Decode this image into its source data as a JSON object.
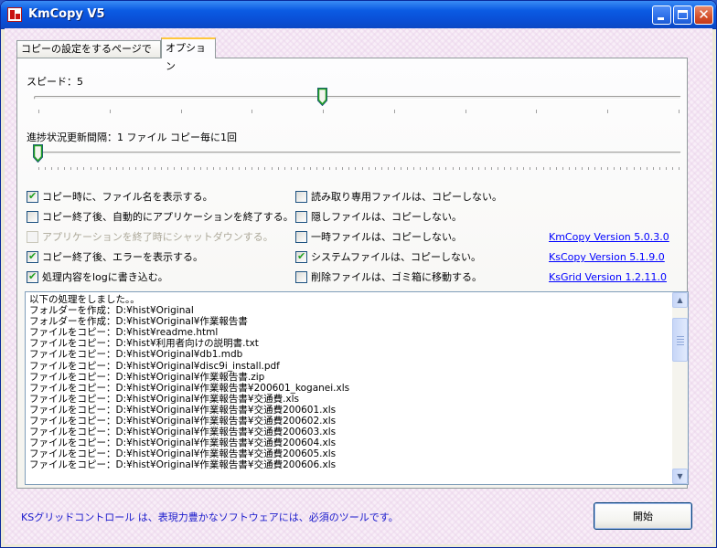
{
  "window": {
    "title": "KmCopy V5"
  },
  "tabs": [
    {
      "label": "コピーの設定をするページです。",
      "active": false
    },
    {
      "label": "オプション",
      "active": true
    }
  ],
  "speed": {
    "label": "スピード：5",
    "value": 5,
    "min": 0,
    "max": 9
  },
  "progress_interval": {
    "label": "進捗状況更新間隔：1 ファイル コピー毎に1回",
    "value": 1
  },
  "checkboxes_left": [
    {
      "label": "コピー時に、ファイル名を表示する。",
      "checked": true,
      "enabled": true
    },
    {
      "label": "コピー終了後、自動的にアプリケーションを終了する。",
      "checked": false,
      "enabled": true
    },
    {
      "label": "アプリケーションを終了時にシャットダウンする。",
      "checked": false,
      "enabled": false
    },
    {
      "label": "コピー終了後、エラーを表示する。",
      "checked": true,
      "enabled": true
    },
    {
      "label": "処理内容をlogに書き込む。",
      "checked": true,
      "enabled": true
    }
  ],
  "checkboxes_right": [
    {
      "label": "読み取り専用ファイルは、コピーしない。",
      "checked": false
    },
    {
      "label": "隠しファイルは、コピーしない。",
      "checked": false
    },
    {
      "label": "一時ファイルは、コピーしない。",
      "checked": false
    },
    {
      "label": "システムファイルは、コピーしない。",
      "checked": true
    },
    {
      "label": "削除ファイルは、ゴミ箱に移動する。",
      "checked": false
    }
  ],
  "version_links": [
    "KmCopy Version 5.0.3.0",
    "KsCopy Version 5.1.9.0",
    "KsGrid Version 1.2.11.0"
  ],
  "log_lines": [
    "以下の処理をしました。。",
    "フォルダーを作成：D:¥hist¥Original",
    "フォルダーを作成：D:¥hist¥Original¥作業報告書",
    "ファイルをコピー：D:¥hist¥readme.html",
    "ファイルをコピー：D:¥hist¥利用者向けの説明書.txt",
    "ファイルをコピー：D:¥hist¥Original¥db1.mdb",
    "ファイルをコピー：D:¥hist¥Original¥disc9i_install.pdf",
    "ファイルをコピー：D:¥hist¥Original¥作業報告書.zip",
    "ファイルをコピー：D:¥hist¥Original¥作業報告書¥200601_koganei.xls",
    "ファイルをコピー：D:¥hist¥Original¥作業報告書¥交通費.xls",
    "ファイルをコピー：D:¥hist¥Original¥作業報告書¥交通費200601.xls",
    "ファイルをコピー：D:¥hist¥Original¥作業報告書¥交通費200602.xls",
    "ファイルをコピー：D:¥hist¥Original¥作業報告書¥交通費200603.xls",
    "ファイルをコピー：D:¥hist¥Original¥作業報告書¥交通費200604.xls",
    "ファイルをコピー：D:¥hist¥Original¥作業報告書¥交通費200605.xls",
    "ファイルをコピー：D:¥hist¥Original¥作業報告書¥交通費200606.xls"
  ],
  "footer": {
    "text": "KSグリッドコントロール は、表現力豊かなソフトウェアには、必須のツールです。"
  },
  "start_button": {
    "label": "開始"
  }
}
